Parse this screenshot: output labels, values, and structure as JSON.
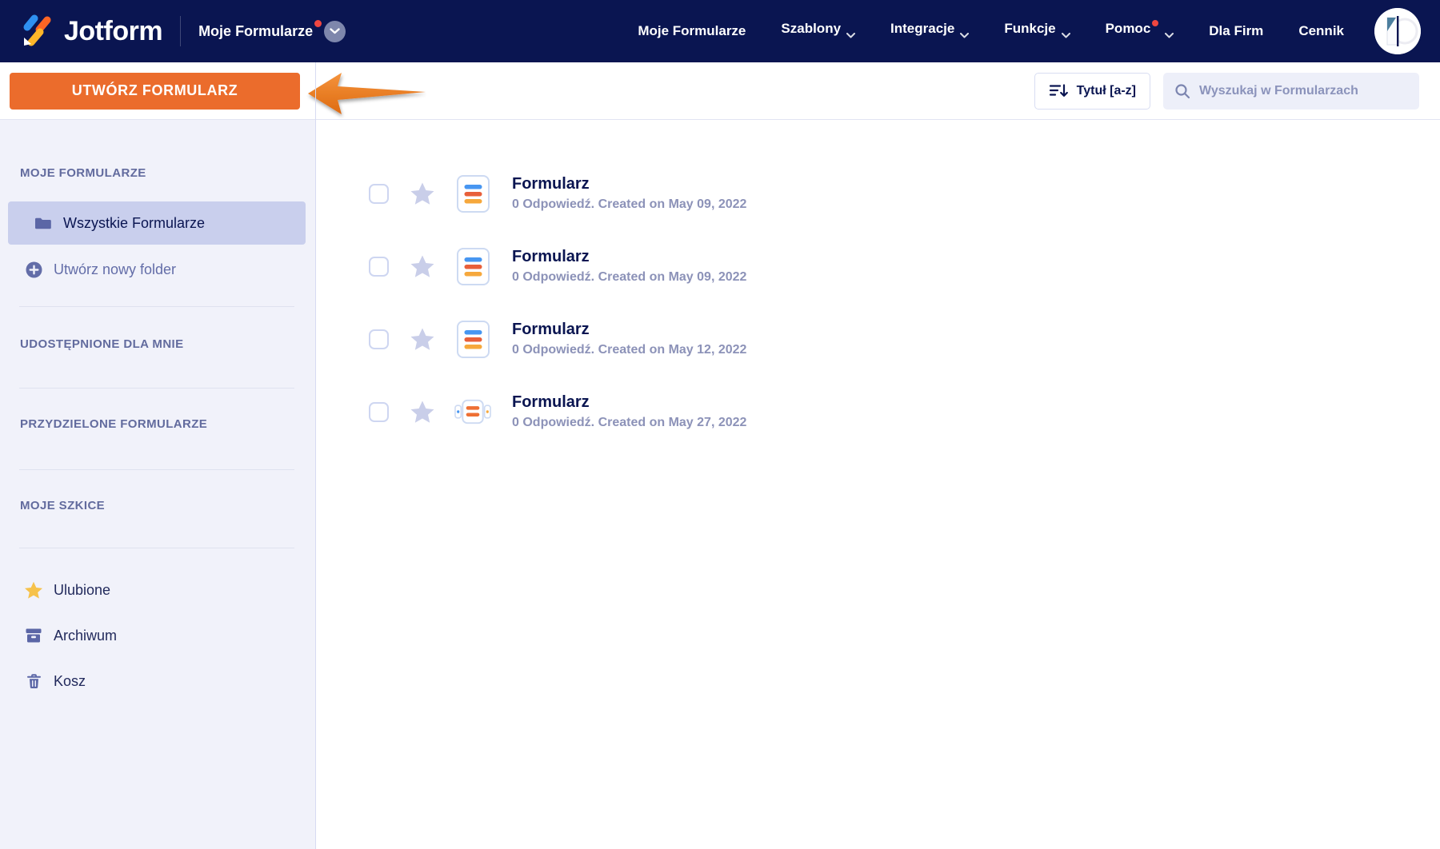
{
  "colors": {
    "brand_navy": "#0a1551",
    "cta_orange": "#eb6c2c",
    "sidebar_background": "#f1f2fa",
    "sidebar_selected": "#c9cfed",
    "favorite_yellow": "#f6c24b",
    "notification_red": "#ef4640",
    "form_icon_blue": "#4796f1",
    "form_icon_orange": "#e85f3a",
    "form_icon_amber": "#f6a83c"
  },
  "navbar": {
    "logo_text": "Jotform",
    "workspace_label": "Moje Formularze",
    "items": [
      {
        "label": "Moje Formularze",
        "chevron": false,
        "dot": false
      },
      {
        "label": "Szablony",
        "chevron": true,
        "dot": false
      },
      {
        "label": "Integracje",
        "chevron": true,
        "dot": false
      },
      {
        "label": "Funkcje",
        "chevron": true,
        "dot": false
      },
      {
        "label": "Pomoc",
        "chevron": true,
        "dot": true
      },
      {
        "label": "Dla Firm",
        "chevron": false,
        "dot": false
      },
      {
        "label": "Cennik",
        "chevron": false,
        "dot": false
      }
    ]
  },
  "toolbar": {
    "create_button_label": "UTWÓRZ FORMULARZ",
    "sort_button_label": "Tytuł [a-z]",
    "search_placeholder": "Wyszukaj w Formularzach"
  },
  "sidebar": {
    "sections": [
      {
        "header": "MOJE FORMULARZE"
      },
      {
        "header": "UDOSTĘPNIONE DLA MNIE"
      },
      {
        "header": "PRZYDZIELONE FORMULARZE"
      },
      {
        "header": "MOJE SZKICE"
      }
    ],
    "items": [
      {
        "label": "Wszystkie Formularze",
        "active": true,
        "icon": "folder-icon"
      },
      {
        "label": "Utwórz nowy folder",
        "active": false,
        "icon": "plus-circle-icon"
      },
      {
        "label": "Ulubione",
        "active": false,
        "icon": "star-icon"
      },
      {
        "label": "Archiwum",
        "active": false,
        "icon": "archive-icon"
      },
      {
        "label": "Kosz",
        "active": false,
        "icon": "trash-icon"
      }
    ]
  },
  "forms": [
    {
      "title": "Formularz",
      "meta": "0 Odpowiedź. Created on May 09, 2022",
      "icon": "classic-form-icon"
    },
    {
      "title": "Formularz",
      "meta": "0 Odpowiedź. Created on May 09, 2022",
      "icon": "classic-form-icon"
    },
    {
      "title": "Formularz",
      "meta": "0 Odpowiedź. Created on May 12, 2022",
      "icon": "classic-form-icon"
    },
    {
      "title": "Formularz",
      "meta": "0 Odpowiedź. Created on May 27, 2022",
      "icon": "card-form-icon"
    }
  ]
}
